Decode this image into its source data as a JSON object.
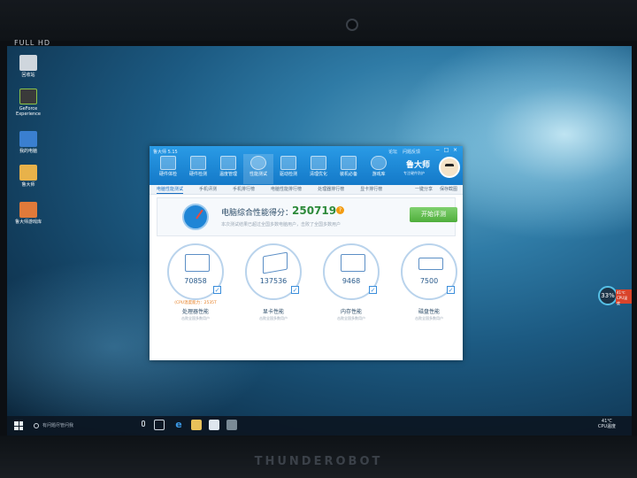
{
  "bezel": {
    "label": "FULL HD",
    "bottom_logo": "THUNDEROBOT"
  },
  "desktop": {
    "icons": [
      {
        "label": "回收站",
        "name": "recycle-bin-icon",
        "color": "#cfd6dd"
      },
      {
        "label": "GeForce Experience",
        "name": "geforce-experience-icon",
        "color": "#3a3a3a"
      },
      {
        "label": "我的电脑",
        "name": "my-computer-icon",
        "color": "#3a7fd0"
      },
      {
        "label": "鲁大师",
        "name": "ludashi-desktop-icon",
        "color": "#e8b24a"
      },
      {
        "label": "鲁大师游戏库",
        "name": "ludashi-gamelib-icon",
        "color": "#e07a3a"
      }
    ]
  },
  "window": {
    "title": "鲁大师 5.15",
    "links": [
      "论坛",
      "问题反馈"
    ],
    "controls": [
      "−",
      "□",
      "×"
    ],
    "brand": "鲁大师",
    "brand_sub": "专注硬件防护",
    "top_tabs": [
      {
        "label": "硬件体检",
        "name": "tab-hardware-check"
      },
      {
        "label": "硬件检测",
        "name": "tab-hardware-detect"
      },
      {
        "label": "温度管理",
        "name": "tab-temperature"
      },
      {
        "label": "性能测试",
        "name": "tab-performance",
        "active": true
      },
      {
        "label": "驱动检测",
        "name": "tab-driver"
      },
      {
        "label": "清理优化",
        "name": "tab-cleanup"
      },
      {
        "label": "装机必备",
        "name": "tab-essentials"
      },
      {
        "label": "游戏库",
        "name": "tab-gamelib"
      }
    ],
    "sub_tabs": [
      {
        "label": "电脑性能测试",
        "active": true
      },
      {
        "label": "手机评测"
      },
      {
        "label": "手机排行榜"
      },
      {
        "label": "电脑性能排行榜"
      },
      {
        "label": "处理器排行榜"
      },
      {
        "label": "显卡排行榜"
      }
    ],
    "sub_right": [
      "一键分享",
      "保存截图"
    ]
  },
  "score": {
    "label": "电脑综合性能得分：",
    "value": "250719",
    "subtitle": "本次测试结果已超过全国多数电脑用户，击败了全国多数用户",
    "start_button": "开始评测"
  },
  "metrics": [
    {
      "value": "70858",
      "note": "(CPU温度能力：2535T",
      "name": "处理器性能",
      "caption": "击败全国多数用户"
    },
    {
      "value": "137536",
      "note": "",
      "name": "显卡性能",
      "caption": "击败全国多数用户"
    },
    {
      "value": "9468",
      "note": "",
      "name": "内存性能",
      "caption": "击败全国多数用户"
    },
    {
      "value": "7500",
      "note": "",
      "name": "磁盘性能",
      "caption": "击败全国多数用户"
    }
  ],
  "temp_widget": {
    "percent": "33%",
    "temp": "41℃",
    "label": "CPU温度"
  },
  "taskbar": {
    "search_placeholder": "有问题尽管问我",
    "tray_temp": "41℃",
    "tray_label": "CPU温度"
  }
}
